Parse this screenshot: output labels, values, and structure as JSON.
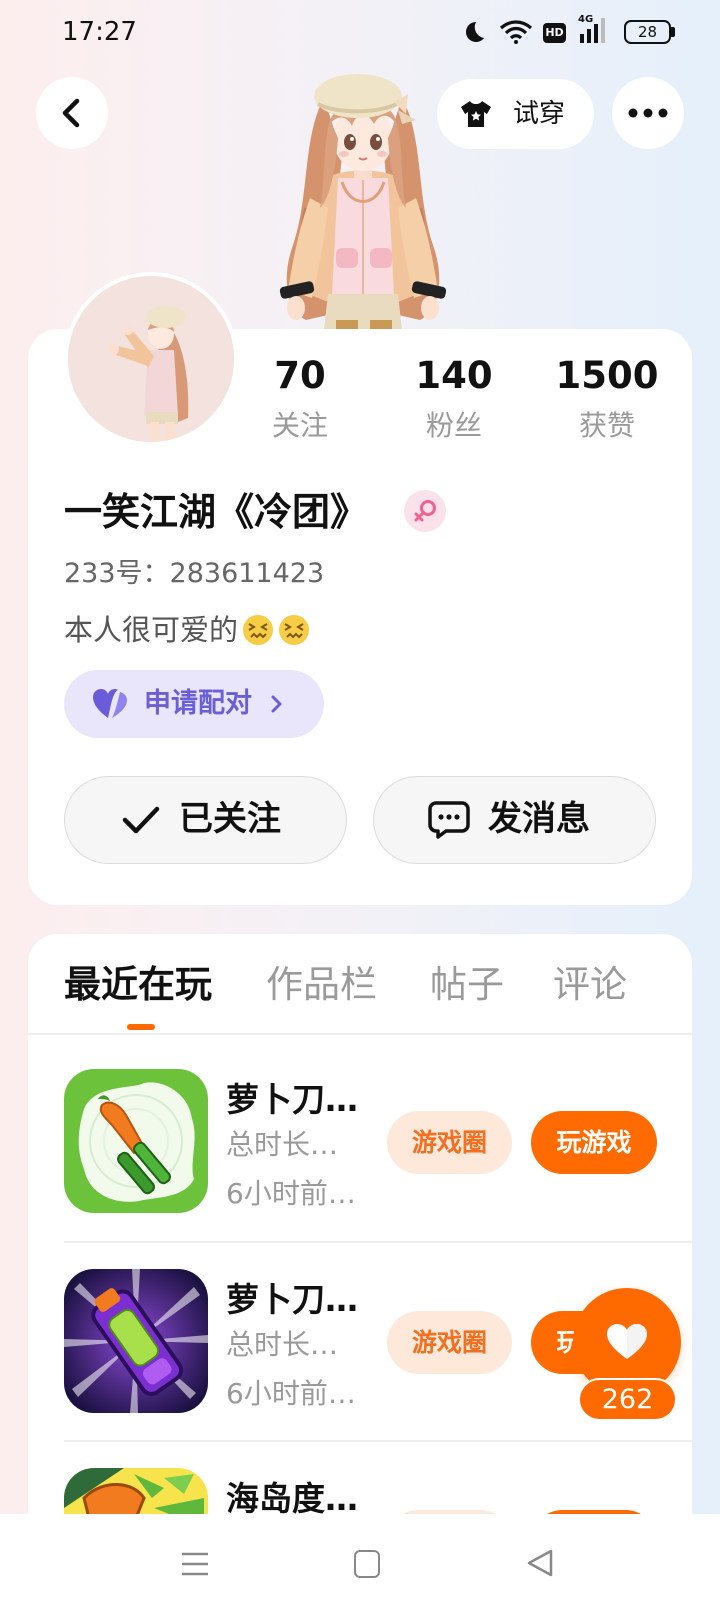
{
  "status_bar": {
    "time": "17:27",
    "hd_badge": "HD",
    "network_type": "4G",
    "battery_level": "28",
    "icons": [
      "moon-icon",
      "wifi-icon",
      "hd-icon",
      "signal-icon",
      "battery-icon"
    ]
  },
  "header": {
    "back_icon": "chevron-left-icon",
    "try_on_label": "试穿",
    "try_on_icon": "tshirt-icon",
    "more_icon": "more-dots-icon"
  },
  "profile": {
    "stats": [
      {
        "value": "70",
        "label": "关注"
      },
      {
        "value": "140",
        "label": "粉丝"
      },
      {
        "value": "1500",
        "label": "获赞"
      }
    ],
    "name": "一笑江湖《冷团》",
    "gender_icon": "female-icon",
    "id_text": "233号：283611423",
    "bio": "本人很可爱的",
    "bio_emojis": [
      "confounded-face-icon",
      "confounded-face-icon"
    ],
    "pair_button": {
      "label": "申请配对",
      "icon": "heart-icon"
    },
    "follow_button": {
      "label": "已关注",
      "icon": "check-icon"
    },
    "message_button": {
      "label": "发消息",
      "icon": "chat-bubble-icon"
    }
  },
  "tabs": [
    {
      "label": "最近在玩",
      "active": true
    },
    {
      "label": "作品栏",
      "active": false
    },
    {
      "label": "帖子",
      "active": false
    },
    {
      "label": "评论",
      "active": false
    }
  ],
  "games": [
    {
      "title": "萝卜刀…",
      "total_time": "总时长…",
      "last_played": "6小时前…",
      "circle_label": "游戏圈",
      "play_label": "玩游戏"
    },
    {
      "title": "萝卜刀…",
      "total_time": "总时长…",
      "last_played": "6小时前…",
      "circle_label": "游戏圈",
      "play_label": "玩游戏"
    },
    {
      "title": "海岛度…"
    }
  ],
  "floating_like": {
    "icon": "heart-icon",
    "count": "262"
  },
  "nav_bar": {
    "icons": [
      "menu-icon",
      "home-square-icon",
      "back-triangle-icon"
    ]
  },
  "colors": {
    "accent": "#ff6a00",
    "accent_light": "#fde8da",
    "pair_bg": "#e9e6fb",
    "pair_text": "#6b5fd6",
    "gender_pink": "#f06292"
  }
}
